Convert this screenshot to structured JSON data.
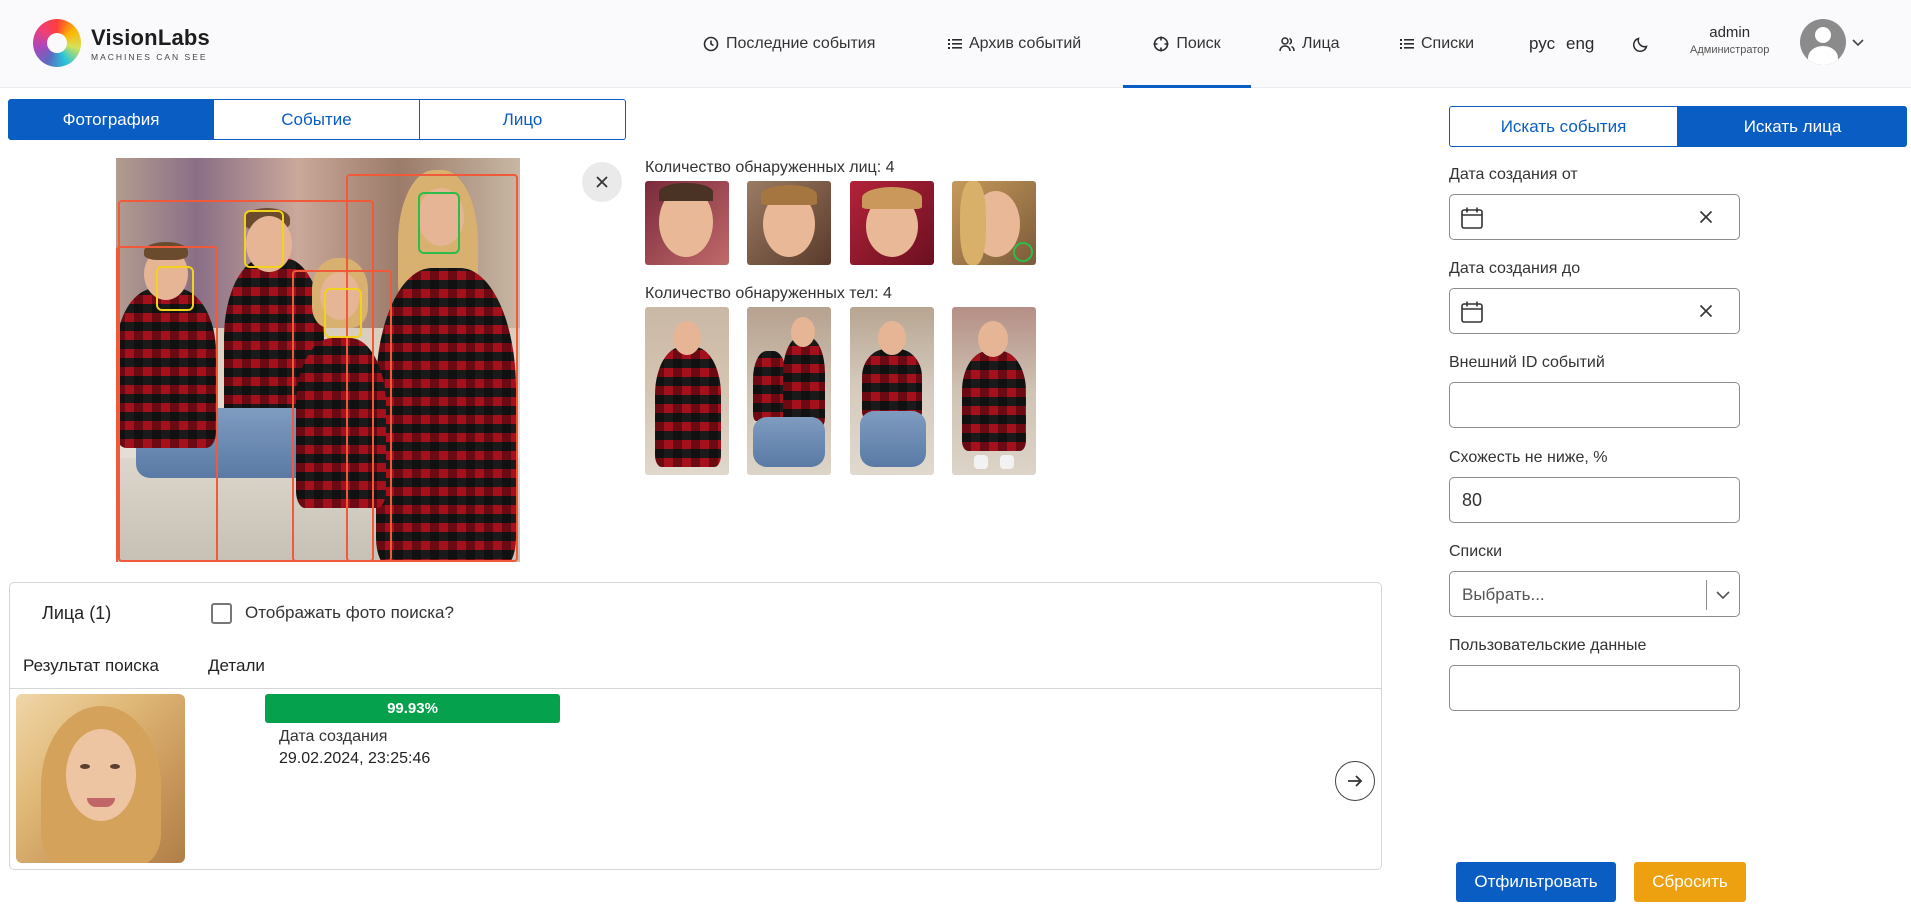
{
  "logo": {
    "name": "VisionLabs",
    "tagline": "MACHINES CAN SEE"
  },
  "nav": {
    "items": [
      {
        "label": "Последние события",
        "icon": "clock-icon"
      },
      {
        "label": "Архив событий",
        "icon": "list-icon"
      },
      {
        "label": "Поиск",
        "icon": "crosshair-icon",
        "active": true
      },
      {
        "label": "Лица",
        "icon": "users-icon"
      },
      {
        "label": "Списки",
        "icon": "list-icon"
      }
    ],
    "lang_ru": "рус",
    "lang_en": "eng",
    "theme_icon": "moon-icon"
  },
  "user": {
    "name": "admin",
    "role": "Администратор"
  },
  "mode_tabs": [
    "Фотография",
    "Событие",
    "Лицо"
  ],
  "detection": {
    "faces_label": "Количество обнаруженных лиц: 4",
    "bodies_label": "Количество обнаруженных тел: 4"
  },
  "results": {
    "title": "Лица (1)",
    "show_photo_label": "Отображать фото поиска?",
    "col_result": "Результат поиска",
    "col_details": "Детали",
    "item": {
      "score": "99.93%",
      "date_label": "Дата создания",
      "date_value": "29.02.2024, 23:25:46"
    }
  },
  "filters": {
    "tab_events": "Искать события",
    "tab_faces": "Искать лица",
    "date_from_label": "Дата создания от",
    "date_to_label": "Дата создания до",
    "external_id_label": "Внешний ID событий",
    "similarity_label": "Схожесть не ниже, %",
    "similarity_value": "80",
    "lists_label": "Списки",
    "lists_placeholder": "Выбрать...",
    "user_data_label": "Пользовательские данные",
    "filter_button": "Отфильтровать",
    "reset_button": "Сбросить"
  },
  "colors": {
    "primary": "#0a5dc2",
    "score_green": "#06a14c",
    "reset_orange": "#eea110",
    "body_box": "#f05a3a",
    "face_box": "#f2d21b",
    "selected_face_box": "#2dbb4c"
  }
}
